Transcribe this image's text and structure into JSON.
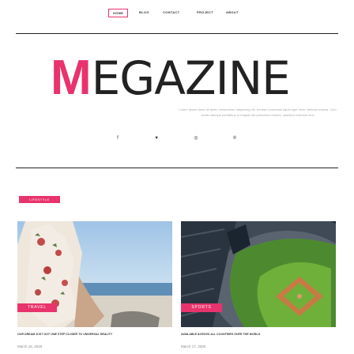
{
  "nav": {
    "items": [
      {
        "label": "Home",
        "active": true
      },
      {
        "label": "Blog"
      },
      {
        "label": "Contact"
      },
      {
        "label": "Project"
      },
      {
        "label": "About"
      }
    ]
  },
  "header": {
    "logo_accent": "M",
    "logo_rest": "EGAZINE",
    "tagline": "Lorem ipsum dolor sit amet, consectetur adipiscing elit. Aenean commodo ligula eget dolor. Aenean massa. Cum sociis natoque penatibus et magnis dis parturient montes, nascetur ridiculus mus"
  },
  "social": [
    {
      "icon": "facebook-icon",
      "glyph": "f"
    },
    {
      "icon": "twitter-icon",
      "glyph": "♥"
    },
    {
      "icon": "instagram-icon",
      "glyph": "◎"
    },
    {
      "icon": "pinterest-icon",
      "glyph": "℗"
    }
  ],
  "section": {
    "label": "LIFESTYLE"
  },
  "posts": [
    {
      "category": "TRAVEL",
      "title": "Our dream just got one step closer to universal reality",
      "date": "March 16, 2020"
    },
    {
      "category": "SPORTS",
      "title": "Available across all countries over the world",
      "date": "March 17, 2020"
    }
  ],
  "colors": {
    "accent": "#e8336d",
    "text": "#222222",
    "muted": "#888888"
  }
}
